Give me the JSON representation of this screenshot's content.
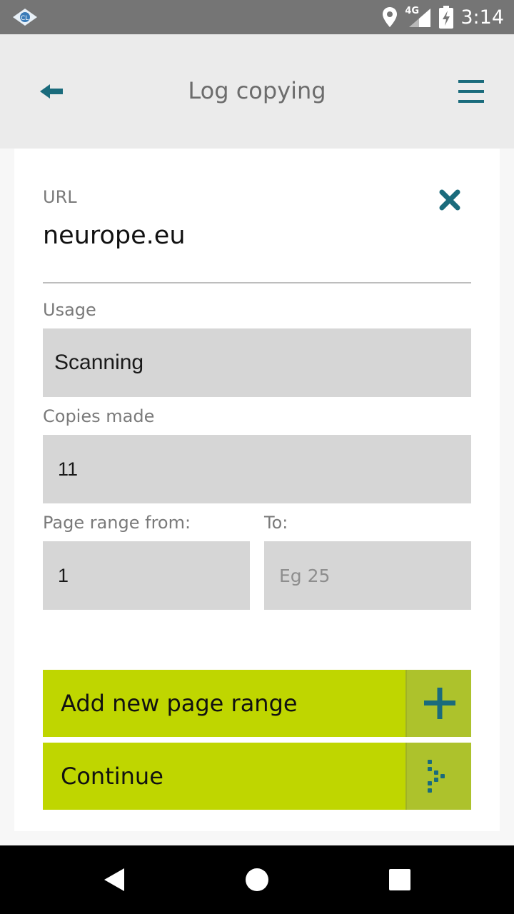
{
  "status_bar": {
    "network": "4G",
    "time": "3:14",
    "icons": [
      "app-logo-icon",
      "location-icon",
      "signal-icon",
      "battery-charging-icon"
    ]
  },
  "app_bar": {
    "title": "Log copying",
    "icons": [
      "back-arrow-icon",
      "hamburger-menu-icon"
    ]
  },
  "form": {
    "url_label": "URL",
    "url_value": "neurope.eu",
    "usage_label": "Usage",
    "usage_value": "Scanning",
    "copies_label": "Copies made",
    "copies_value": "11",
    "range_from_label": "Page range from:",
    "range_from_value": "1",
    "range_to_label": "To:",
    "range_to_placeholder": "Eg 25"
  },
  "buttons": {
    "add_range_label": "Add new page range",
    "continue_label": "Continue"
  },
  "colors": {
    "accent": "#1a6b7c",
    "button": "#bfd600",
    "button_icon_box": "#adc22c",
    "field_bg": "#d6d6d6"
  }
}
